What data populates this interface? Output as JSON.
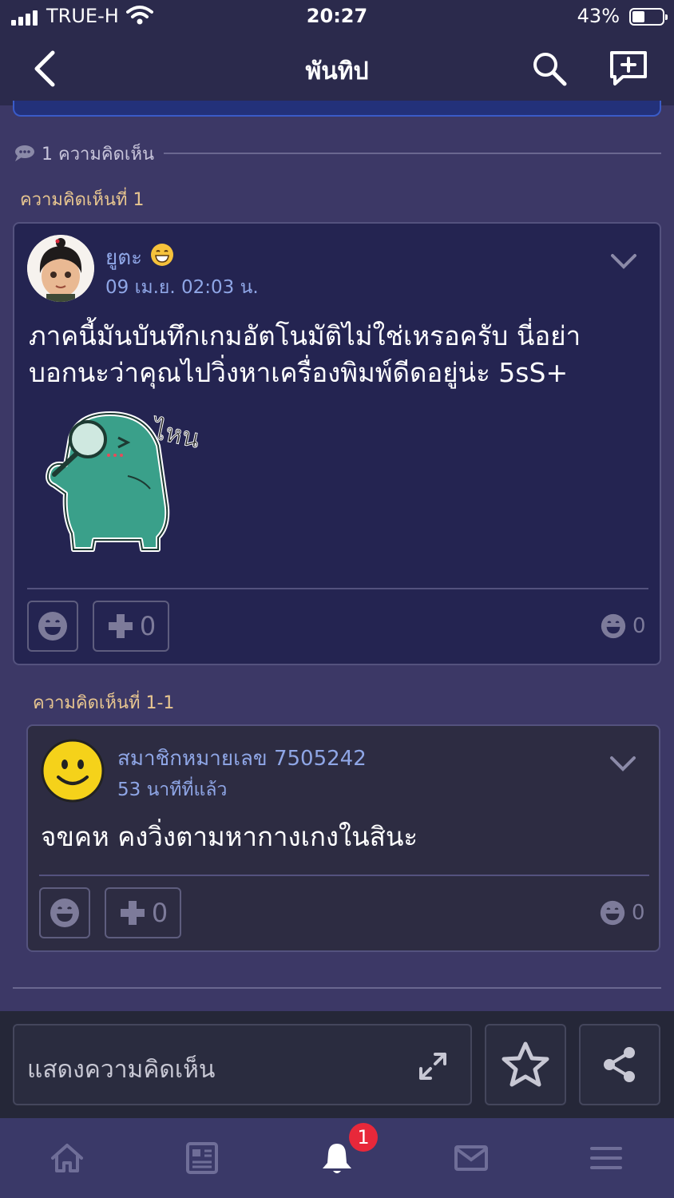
{
  "status_bar": {
    "carrier": "TRUE-H",
    "time": "20:27",
    "battery_percent": "43%",
    "battery_level": 0.43
  },
  "nav": {
    "title": "พันทิป",
    "back_icon": "chevron-left-icon",
    "search_icon": "search-icon",
    "new_topic_icon": "add-topic-icon"
  },
  "comments": {
    "count_label": "1 ความคิดเห็น",
    "items": [
      {
        "label": "ความคิดเห็นที่ 1",
        "author": "ยูตะ",
        "time": "09 เม.ย. 02:03 น.",
        "body_lines": [
          "ภาคนี้มันบันทึกเกมอัตโนมัติไม่ใช่เหรอครับ นี่อย่า",
          "บอกนะว่าคุณไปวิ่งหาเครื่องพิมพ์ดีดอยู่น่ะ 5sS+"
        ],
        "sticker_text": "ไหน",
        "plus_count": "0",
        "reaction_count": "0"
      },
      {
        "label": "ความคิดเห็นที่ 1-1",
        "author": "สมาชิกหมายเลข 7505242",
        "time": "53 นาทีที่แล้ว",
        "body": "จขคห คงวิ่งตามหากางเกงในสินะ",
        "plus_count": "0",
        "reaction_count": "0"
      }
    ]
  },
  "action_bar": {
    "comment_placeholder": "แสดงความคิดเห็น"
  },
  "tabbar": {
    "items": [
      "home-icon",
      "feed-icon",
      "notification-icon",
      "mail-icon",
      "menu-icon"
    ],
    "notification_badge": "1"
  },
  "colors": {
    "background": "#3c3866",
    "card": "#242451",
    "reply_card": "#2d2c42",
    "link": "#8fa6e6",
    "label": "#e8c690",
    "badge": "#e8283a"
  }
}
